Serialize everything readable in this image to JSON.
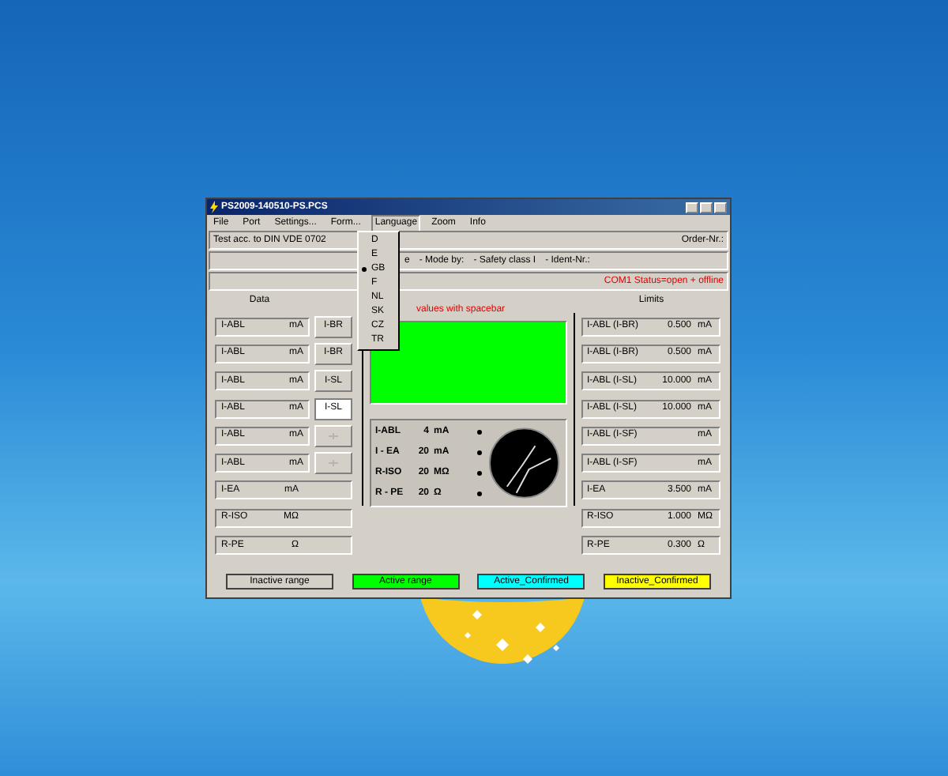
{
  "window": {
    "title": "PS2009-140510-PS.PCS"
  },
  "menu": [
    {
      "label": "File",
      "selected": false
    },
    {
      "label": "Port",
      "selected": false
    },
    {
      "label": "Settings...",
      "selected": false
    },
    {
      "label": "Form...",
      "selected": false
    },
    {
      "label": "Language",
      "selected": true
    },
    {
      "label": "Zoom",
      "selected": false
    },
    {
      "label": "Info",
      "selected": false
    }
  ],
  "language_menu": [
    {
      "label": "D",
      "selected": false
    },
    {
      "label": "E",
      "selected": false
    },
    {
      "label": "GB",
      "selected": true
    },
    {
      "label": "F",
      "selected": false
    },
    {
      "label": "NL",
      "selected": false
    },
    {
      "label": "SK",
      "selected": false
    },
    {
      "label": "CZ",
      "selected": false
    },
    {
      "label": "TR",
      "selected": false
    }
  ],
  "header": {
    "standard": "Test acc. to DIN VDE 0702",
    "order": "Order-Nr.:",
    "fields": [
      "e",
      "- Mode by:",
      "- Safety class I",
      "- Ident-Nr.:"
    ],
    "status": "COM1 Status=open + offline"
  },
  "data": {
    "title": "Data",
    "rows": [
      {
        "label": "I-ABL",
        "unit": "mA",
        "button": {
          "label": "I-BR",
          "pressed": false,
          "disabled": false
        }
      },
      {
        "label": "I-ABL",
        "unit": "mA",
        "button": {
          "label": "I-BR",
          "pressed": false,
          "disabled": false
        }
      },
      {
        "label": "I-ABL",
        "unit": "mA",
        "button": {
          "label": "I-SL",
          "pressed": false,
          "disabled": false
        }
      },
      {
        "label": "I-ABL",
        "unit": "mA",
        "button": {
          "label": "I-SL",
          "pressed": true,
          "disabled": false
        }
      },
      {
        "label": "I-ABL",
        "unit": "mA",
        "button": {
          "disabled": true
        }
      },
      {
        "label": "I-ABL",
        "unit": "mA",
        "button": {
          "disabled": true
        }
      },
      {
        "label": "I-EA",
        "unit": "mA"
      },
      {
        "label": "R-ISO",
        "unit": "MΩ"
      },
      {
        "label": "R-PE",
        "unit": "Ω"
      }
    ]
  },
  "display": {
    "hint": "values with spacebar",
    "readings": [
      {
        "name": "I-ABL",
        "value": "4",
        "unit": "mA"
      },
      {
        "name": "I - EA",
        "value": "20",
        "unit": "mA"
      },
      {
        "name": "R-ISO",
        "value": "20",
        "unit": "MΩ"
      },
      {
        "name": "R - PE",
        "value": "20",
        "unit": "Ω"
      }
    ]
  },
  "limits": {
    "title": "Limits",
    "rows": [
      {
        "label": "I-ABL (I-BR)",
        "value": "0.500",
        "unit": "mA"
      },
      {
        "label": "I-ABL (I-BR)",
        "value": "0.500",
        "unit": "mA"
      },
      {
        "label": "I-ABL (I-SL)",
        "value": "10.000",
        "unit": "mA"
      },
      {
        "label": "I-ABL (I-SL)",
        "value": "10.000",
        "unit": "mA"
      },
      {
        "label": "I-ABL (I-SF)",
        "unit": "mA"
      },
      {
        "label": "I-ABL (I-SF)",
        "unit": "mA"
      },
      {
        "label": "I-EA",
        "value": "3.500",
        "unit": "mA"
      },
      {
        "label": "R-ISO",
        "value": "1.000",
        "unit": "MΩ"
      },
      {
        "label": "R-PE",
        "value": "0.300",
        "unit": "Ω"
      }
    ]
  },
  "legend": [
    {
      "label": "Inactive range",
      "color": "#d4d0c8"
    },
    {
      "label": "Active range",
      "color": "#00ff00"
    },
    {
      "label": "Active_Confirmed",
      "color": "#00ffff"
    },
    {
      "label": "Inactive_Confirmed",
      "color": "#ffff00"
    }
  ]
}
